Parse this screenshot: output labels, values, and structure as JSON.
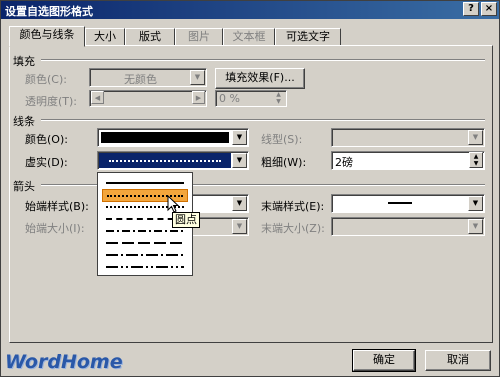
{
  "window": {
    "title": "设置自选图形格式",
    "help_label": "?",
    "close_label": "×"
  },
  "tabs": [
    {
      "label": "颜色与线条",
      "active": true,
      "enabled": true
    },
    {
      "label": "大小",
      "active": false,
      "enabled": true
    },
    {
      "label": "版式",
      "active": false,
      "enabled": true
    },
    {
      "label": "图片",
      "active": false,
      "enabled": false
    },
    {
      "label": "文本框",
      "active": false,
      "enabled": false
    },
    {
      "label": "可选文字",
      "active": false,
      "enabled": true
    }
  ],
  "fill": {
    "section_label": "填充",
    "color_label": "颜色(C):",
    "color_value": "无颜色",
    "fill_effect_label": "填充效果(F)...",
    "transparency_label": "透明度(T):",
    "transparency_value": "0 %"
  },
  "line": {
    "section_label": "线条",
    "color_label": "颜色(O):",
    "color_value": "#000000",
    "dash_label": "虚实(D):",
    "style_label": "线型(S):",
    "weight_label": "粗细(W):",
    "weight_value": "2磅"
  },
  "arrows": {
    "section_label": "箭头",
    "begin_style_label": "始端样式(B):",
    "begin_size_label": "始端大小(I):",
    "end_style_label": "末端样式(E):",
    "end_size_label": "末端大小(Z):"
  },
  "dash_options": [
    "solid",
    "round-dot",
    "square-dot",
    "dash",
    "dash-dot",
    "long-dash",
    "long-dash-dot",
    "long-dash-dot-dot"
  ],
  "dash_selected": "round-dot",
  "tooltip": "圆点",
  "buttons": {
    "ok": "确定",
    "cancel": "取消"
  },
  "logo": "WordHome",
  "colors": {
    "selection": "#0a246a",
    "highlight": "#f3a63c",
    "dialog": "#d4d0c8"
  }
}
